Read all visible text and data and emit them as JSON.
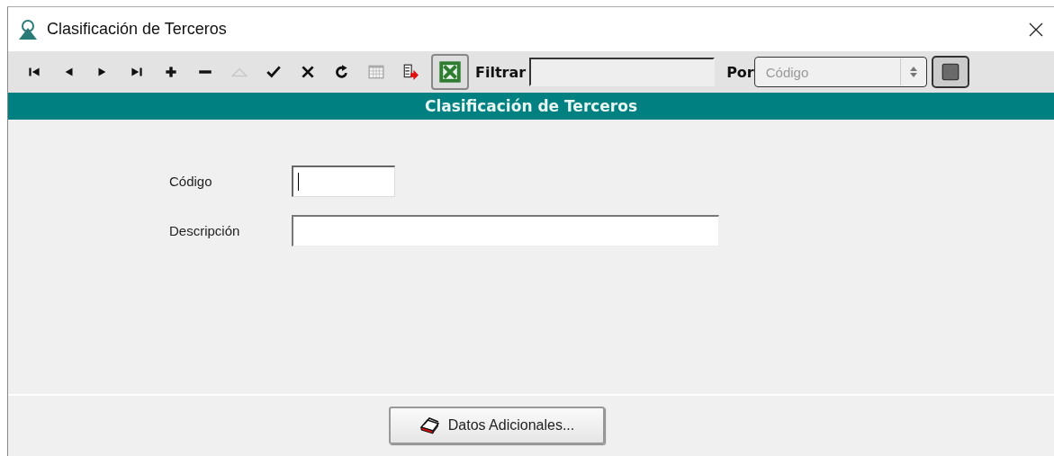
{
  "window": {
    "title": "Clasificación de Terceros"
  },
  "toolbar": {
    "buttons": [
      {
        "kind": "first",
        "disabled": false
      },
      {
        "kind": "prior",
        "disabled": false
      },
      {
        "kind": "next",
        "disabled": false
      },
      {
        "kind": "last",
        "disabled": false
      },
      {
        "kind": "insert",
        "disabled": false
      },
      {
        "kind": "delete",
        "disabled": false
      },
      {
        "kind": "edit",
        "disabled": true
      },
      {
        "kind": "post",
        "disabled": false
      },
      {
        "kind": "cancel",
        "disabled": false
      },
      {
        "kind": "refresh",
        "disabled": false
      },
      {
        "kind": "grid",
        "disabled": false
      },
      {
        "kind": "export",
        "disabled": false
      },
      {
        "kind": "excel",
        "disabled": false
      }
    ],
    "filter": {
      "label": "Filtrar"
    },
    "by": {
      "label": "Por",
      "value": "Código",
      "disabled": true
    }
  },
  "header": "Clasificación de Terceros",
  "fields": [
    {
      "label": "Código",
      "focused": true,
      "kind": "short"
    },
    {
      "label": "Descripción",
      "focused": false,
      "kind": "long"
    }
  ],
  "footer_button": "Datos Adicionales..."
}
